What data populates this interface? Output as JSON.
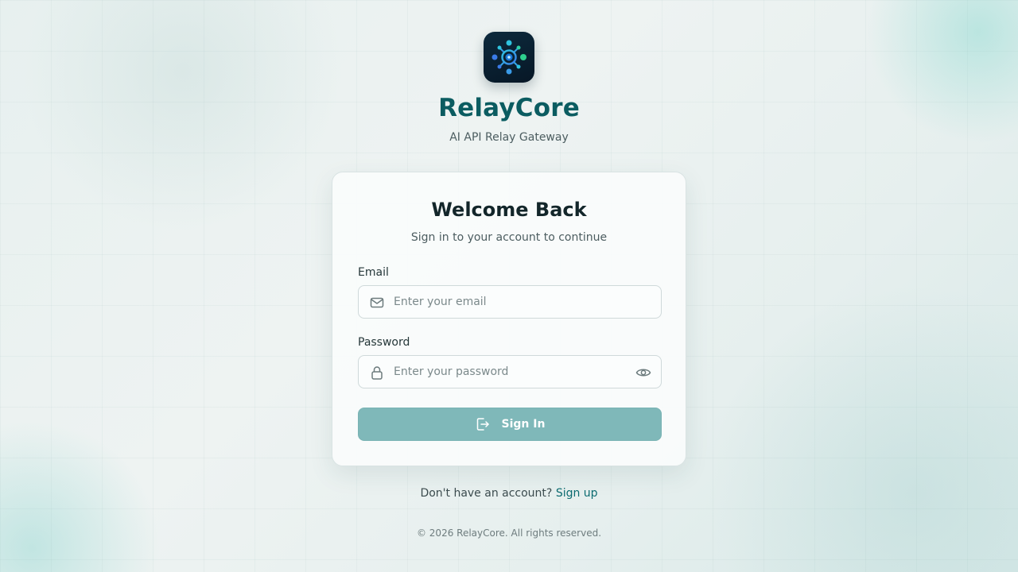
{
  "brand": {
    "name": "RelayCore",
    "tagline": "AI API Relay Gateway",
    "logo_icon": "relay-hub-icon"
  },
  "login_card": {
    "title": "Welcome Back",
    "subtitle": "Sign in to your account to continue",
    "email": {
      "label": "Email",
      "placeholder": "Enter your email",
      "value": "",
      "icon": "mail-icon"
    },
    "password": {
      "label": "Password",
      "placeholder": "Enter your password",
      "value": "",
      "icon": "lock-icon",
      "toggle_icon": "eye-icon"
    },
    "submit": {
      "label": "Sign In",
      "icon": "log-in-icon"
    }
  },
  "signup": {
    "prompt": "Don't have an account?",
    "link_label": "Sign up"
  },
  "footer": {
    "copyright": "© 2026 RelayCore. All rights reserved."
  },
  "colors": {
    "brand_teal": "#0b5c61",
    "button_bg": "#7fb8b9",
    "link": "#0c6b70",
    "logo_bg": "#0d2a3d"
  }
}
